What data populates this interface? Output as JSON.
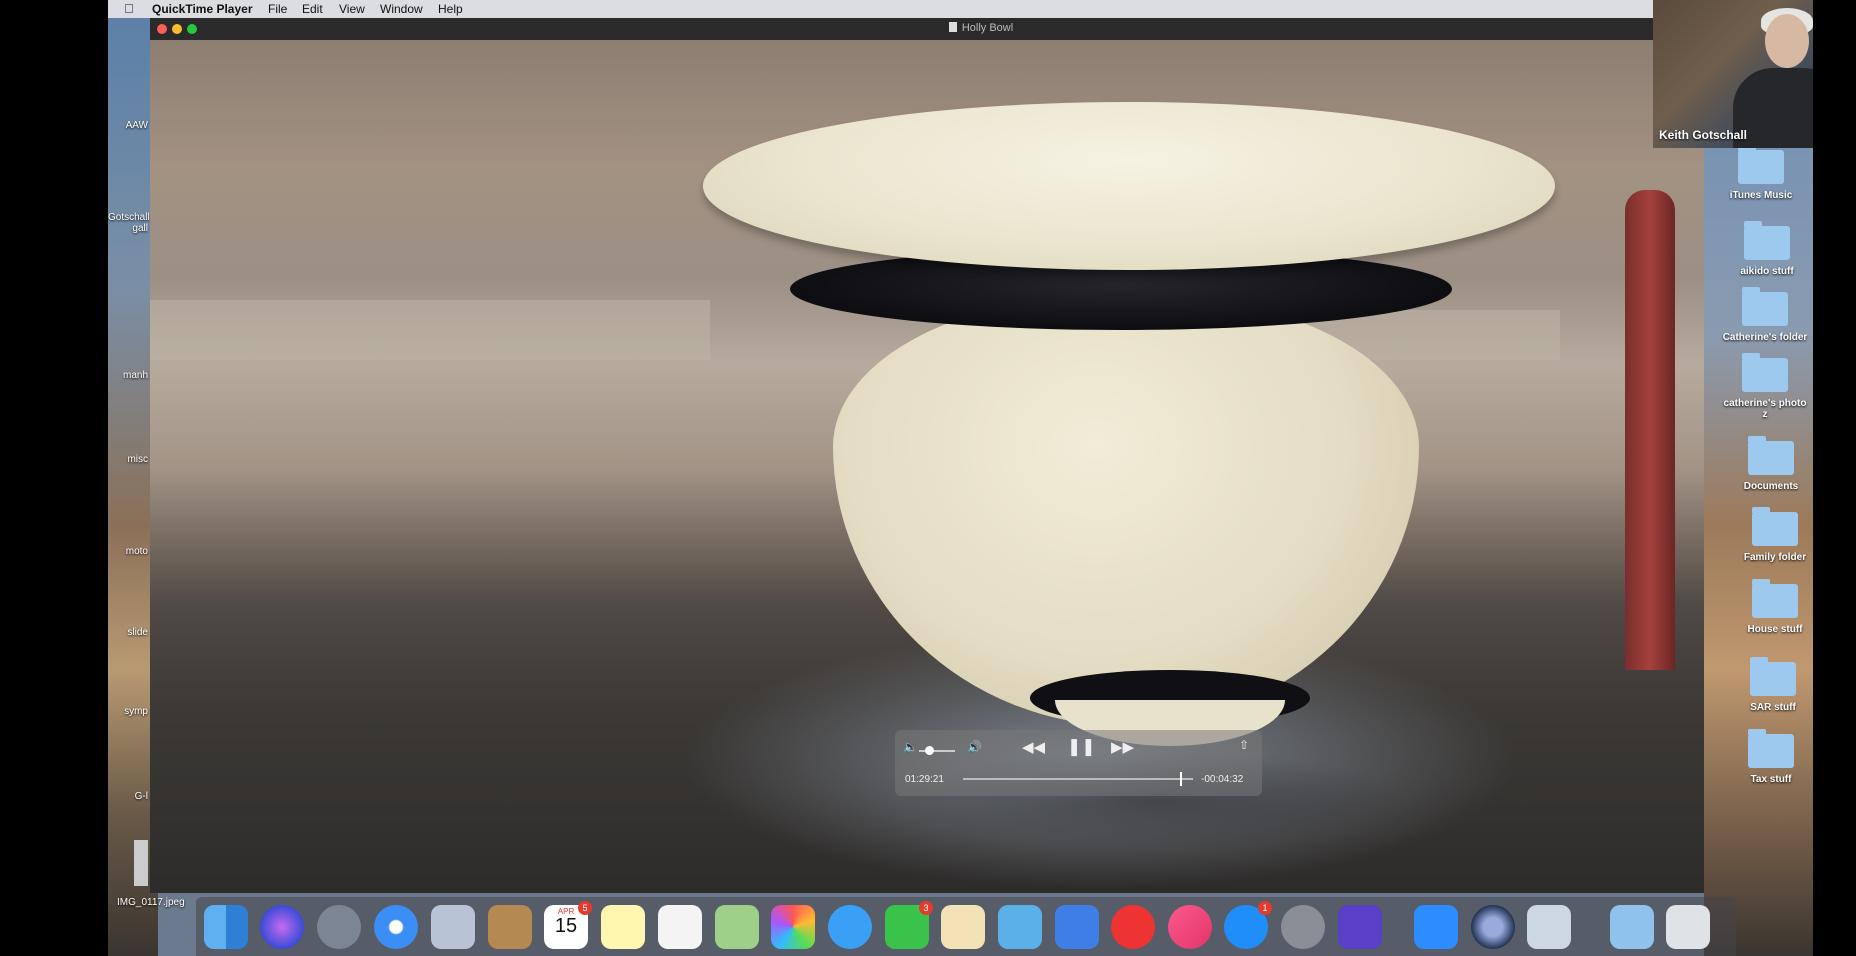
{
  "menubar": {
    "app_name": "QuickTime Player",
    "items": [
      "File",
      "Edit",
      "View",
      "Window",
      "Help"
    ]
  },
  "window": {
    "title": "Holly Bowl"
  },
  "player": {
    "elapsed": "01:29:21",
    "remaining": "-00:04:32",
    "volume_level": 0.3,
    "progress": 0.95
  },
  "webcam": {
    "name": "Keith Gotschall"
  },
  "desktop_right": [
    {
      "label": "iTunes Music"
    },
    {
      "label": "aikido stuff"
    },
    {
      "label": "Catherine's folder"
    },
    {
      "label": "catherine's photo\nz"
    },
    {
      "label": "Documents"
    },
    {
      "label": "Family folder"
    },
    {
      "label": "House stuff"
    },
    {
      "label": "SAR stuff"
    },
    {
      "label": "Tax stuff"
    }
  ],
  "desktop_left": [
    "AAW",
    "Gotschall\ngall",
    "manh",
    "misc",
    "moto",
    "slide",
    "symp",
    "G-l"
  ],
  "desktop_file": "IMG_0117.jpeg",
  "dock": {
    "calendar_month": "APR",
    "calendar_day": "15",
    "calendar_badge": "5",
    "facetime_badge": "3",
    "appstore_badge": "1"
  }
}
